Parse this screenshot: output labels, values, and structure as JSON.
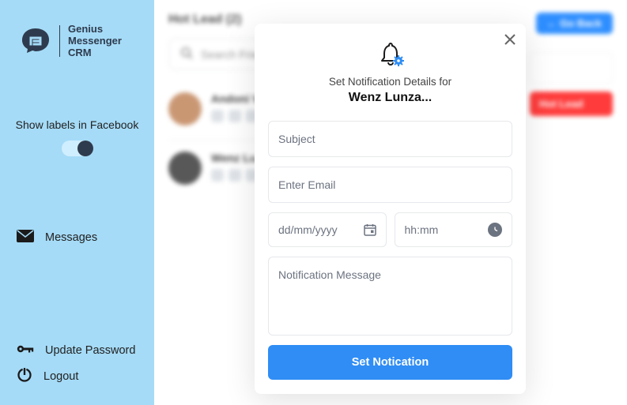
{
  "brand": {
    "line1": "Genius",
    "line2": "Messenger",
    "line3": "CRM"
  },
  "sidebar": {
    "show_labels_text": "Show labels in Facebook",
    "messages_label": "Messages",
    "update_password_label": "Update Password",
    "logout_label": "Logout"
  },
  "main": {
    "title": "Hot Lead (2)",
    "go_back_label": "← Go Back",
    "search_placeholder": "Search Friends",
    "hot_lead_chip": "Hot Lead",
    "friends": [
      {
        "name": "Andoni V..."
      },
      {
        "name": "Wenz Lu..."
      }
    ]
  },
  "modal": {
    "subtitle": "Set Notification Details for",
    "contact_name": "Wenz Lunza...",
    "subject_placeholder": "Subject",
    "email_placeholder": "Enter Email",
    "date_placeholder": "dd/mm/yyyy",
    "time_placeholder": "hh:mm",
    "message_placeholder": "Notification Message",
    "button_label": "Set Notication"
  }
}
